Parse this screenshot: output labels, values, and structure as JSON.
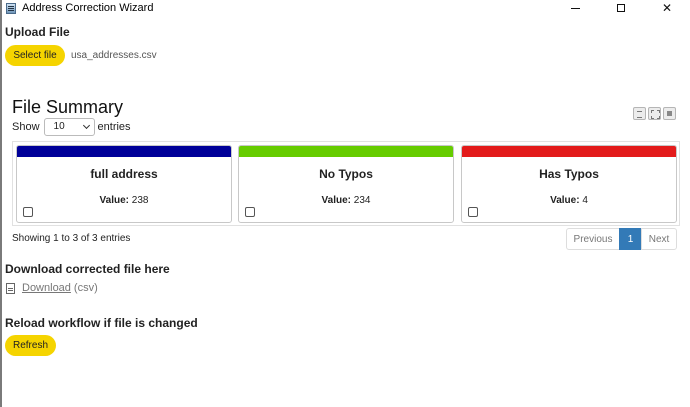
{
  "window": {
    "title": "Address Correction Wizard"
  },
  "upload": {
    "heading": "Upload File",
    "button_label": "Select file",
    "file_name": "usa_addresses.csv"
  },
  "summary": {
    "title": "File Summary",
    "show_label": "Show",
    "page_size": "10",
    "entries_label": "entries",
    "cards": [
      {
        "title": "full address",
        "value_label": "Value:",
        "value": "238",
        "color": "#000099"
      },
      {
        "title": "No Typos",
        "value_label": "Value:",
        "value": "234",
        "color": "#66cc00"
      },
      {
        "title": "Has Typos",
        "value_label": "Value:",
        "value": "4",
        "color": "#e31b1b"
      }
    ],
    "info": "Showing 1 to 3 of 3 entries",
    "pagination": {
      "previous": "Previous",
      "current": "1",
      "next": "Next"
    }
  },
  "download": {
    "heading": "Download corrected file here",
    "link_text": "Download",
    "format": "(csv)"
  },
  "reload": {
    "heading": "Reload workflow if file is changed",
    "button_label": "Refresh"
  },
  "colors": {
    "accent_yellow": "#f5d400",
    "pager_active": "#337ab7"
  }
}
